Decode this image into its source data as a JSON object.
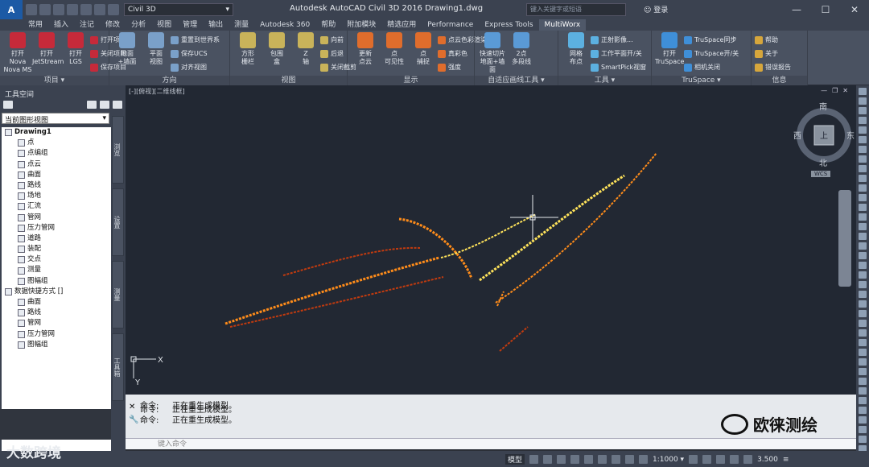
{
  "titlebar": {
    "app_logo": "A",
    "app_logo_sub": "CIV",
    "workspace": "Civil 3D",
    "window_title": "Autodesk AutoCAD Civil 3D 2016    Drawing1.dwg",
    "search_placeholder": "键入关键字或短语",
    "signin": "登录",
    "controls": [
      "—",
      "☐",
      "✕"
    ]
  },
  "tabs": [
    "常用",
    "插入",
    "注记",
    "修改",
    "分析",
    "视图",
    "管理",
    "输出",
    "测量",
    "Autodesk 360",
    "帮助",
    "附加模块",
    "精选应用",
    "Performance",
    "Express Tools",
    "MultiWorx"
  ],
  "active_tab": "MultiWorx",
  "ribbon": {
    "panels": [
      {
        "title": "项目 ▾",
        "big": [
          "打开Nova\nNova MS",
          "打开\nJetStream",
          "打开\nLGS"
        ],
        "small": [
          "打开项目",
          "关闭项目",
          "保存项目"
        ]
      },
      {
        "title": "方向",
        "big": [
          "地面\n+墙面",
          "平面\n视图"
        ],
        "small": [
          "重置到世界系",
          "保存UCS",
          "对齐视图"
        ]
      },
      {
        "title": "视图",
        "big": [
          "方形\n栅栏",
          "包围\n盒",
          "Z\n轴"
        ],
        "small": [
          "向前",
          "后退",
          "关闭截剪"
        ]
      },
      {
        "title": "显示",
        "big": [
          "更新\n点云",
          "点\n可见性",
          "点\n捕捉"
        ],
        "small": [
          "点云色彩渲染",
          "真彩色",
          "强度"
        ]
      },
      {
        "title": "自适应画线工具 ▾",
        "big": [
          "快速切片\n地面+墙面",
          "2点\n多段线"
        ],
        "small": []
      },
      {
        "title": "工具 ▾",
        "big": [
          "网格\n布点"
        ],
        "small": [
          "正射影像...",
          "工作平面开/关",
          "SmartPick视窗"
        ]
      },
      {
        "title": "TruSpace ▾",
        "big": [
          "打开\nTruSpace"
        ],
        "small": [
          "TruSpace同步",
          "TruSpace开/关",
          "相机关闭"
        ]
      },
      {
        "title": "信息",
        "big": [],
        "small": [
          "帮助",
          "关于",
          "错误报告"
        ]
      }
    ]
  },
  "toolspace": {
    "title": "工具空间",
    "view_select": "当前图形视图",
    "vtabs": [
      "浏览",
      "设置",
      "测量",
      "工具箱"
    ],
    "tree": [
      {
        "label": "Drawing1",
        "level": 0,
        "root": true
      },
      {
        "label": "点",
        "level": 1
      },
      {
        "label": "点编组",
        "level": 1
      },
      {
        "label": "点云",
        "level": 1
      },
      {
        "label": "曲面",
        "level": 1
      },
      {
        "label": "路线",
        "level": 1
      },
      {
        "label": "场地",
        "level": 1
      },
      {
        "label": "汇流",
        "level": 1
      },
      {
        "label": "管网",
        "level": 1
      },
      {
        "label": "压力管网",
        "level": 1
      },
      {
        "label": "道路",
        "level": 1
      },
      {
        "label": "装配",
        "level": 1
      },
      {
        "label": "交点",
        "level": 1
      },
      {
        "label": "测量",
        "level": 1
      },
      {
        "label": "图幅组",
        "level": 1
      },
      {
        "label": "数据快捷方式 []",
        "level": 0,
        "root": false
      },
      {
        "label": "曲面",
        "level": 1
      },
      {
        "label": "路线",
        "level": 1
      },
      {
        "label": "管网",
        "level": 1
      },
      {
        "label": "压力管网",
        "level": 1
      },
      {
        "label": "图幅组",
        "level": 1
      }
    ]
  },
  "viewport": {
    "label": "[-][俯视][二维线框]",
    "compass": {
      "north": "北",
      "south": "南",
      "east": "东",
      "west": "西",
      "center": "上",
      "ucs": "WCS"
    },
    "ucs_x": "X",
    "ucs_y": "Y",
    "colors": {
      "bg": "#222833",
      "point_hot": "#ffe35a",
      "point_mid": "#ff8c1a",
      "point_low": "#c23b0f"
    }
  },
  "command": {
    "history": [
      {
        "prefix": "命令:",
        "text": "正在重生成模型。"
      },
      {
        "prefix": "命令:",
        "text": "正在重生成模型。"
      },
      {
        "prefix": "命令:",
        "text": "正在重生成模型。"
      }
    ],
    "placeholder": "键入命令"
  },
  "statusbar": {
    "model": "模型",
    "scale": "1:1000 ▾",
    "value": "3.500"
  },
  "watermarks": {
    "left": "大数跨境",
    "right": "欧徕测绘"
  }
}
